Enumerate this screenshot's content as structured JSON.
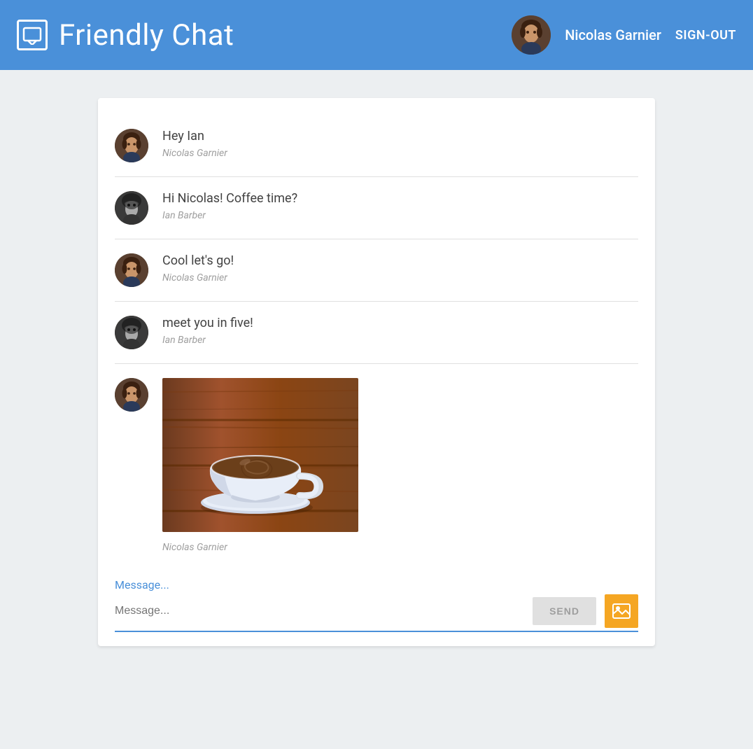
{
  "header": {
    "title": "Friendly Chat",
    "username": "Nicolas Garnier",
    "signout_label": "SIGN-OUT",
    "chat_icon": "💬"
  },
  "messages": [
    {
      "id": 1,
      "text": "Hey Ian",
      "author": "Nicolas Garnier",
      "avatar_type": "nicolas"
    },
    {
      "id": 2,
      "text": "Hi Nicolas! Coffee time?",
      "author": "Ian Barber",
      "avatar_type": "ian"
    },
    {
      "id": 3,
      "text": "Cool let's go!",
      "author": "Nicolas Garnier",
      "avatar_type": "nicolas"
    },
    {
      "id": 4,
      "text": "meet you in five!",
      "author": "Ian Barber",
      "avatar_type": "ian"
    },
    {
      "id": 5,
      "text": "",
      "author": "Nicolas Garnier",
      "avatar_type": "nicolas",
      "has_image": true
    }
  ],
  "input": {
    "placeholder": "Message...",
    "send_label": "SEND",
    "image_icon": "🖼"
  },
  "colors": {
    "header_bg": "#4a90d9",
    "accent": "#4a90d9",
    "image_upload_bg": "#f5a623"
  }
}
